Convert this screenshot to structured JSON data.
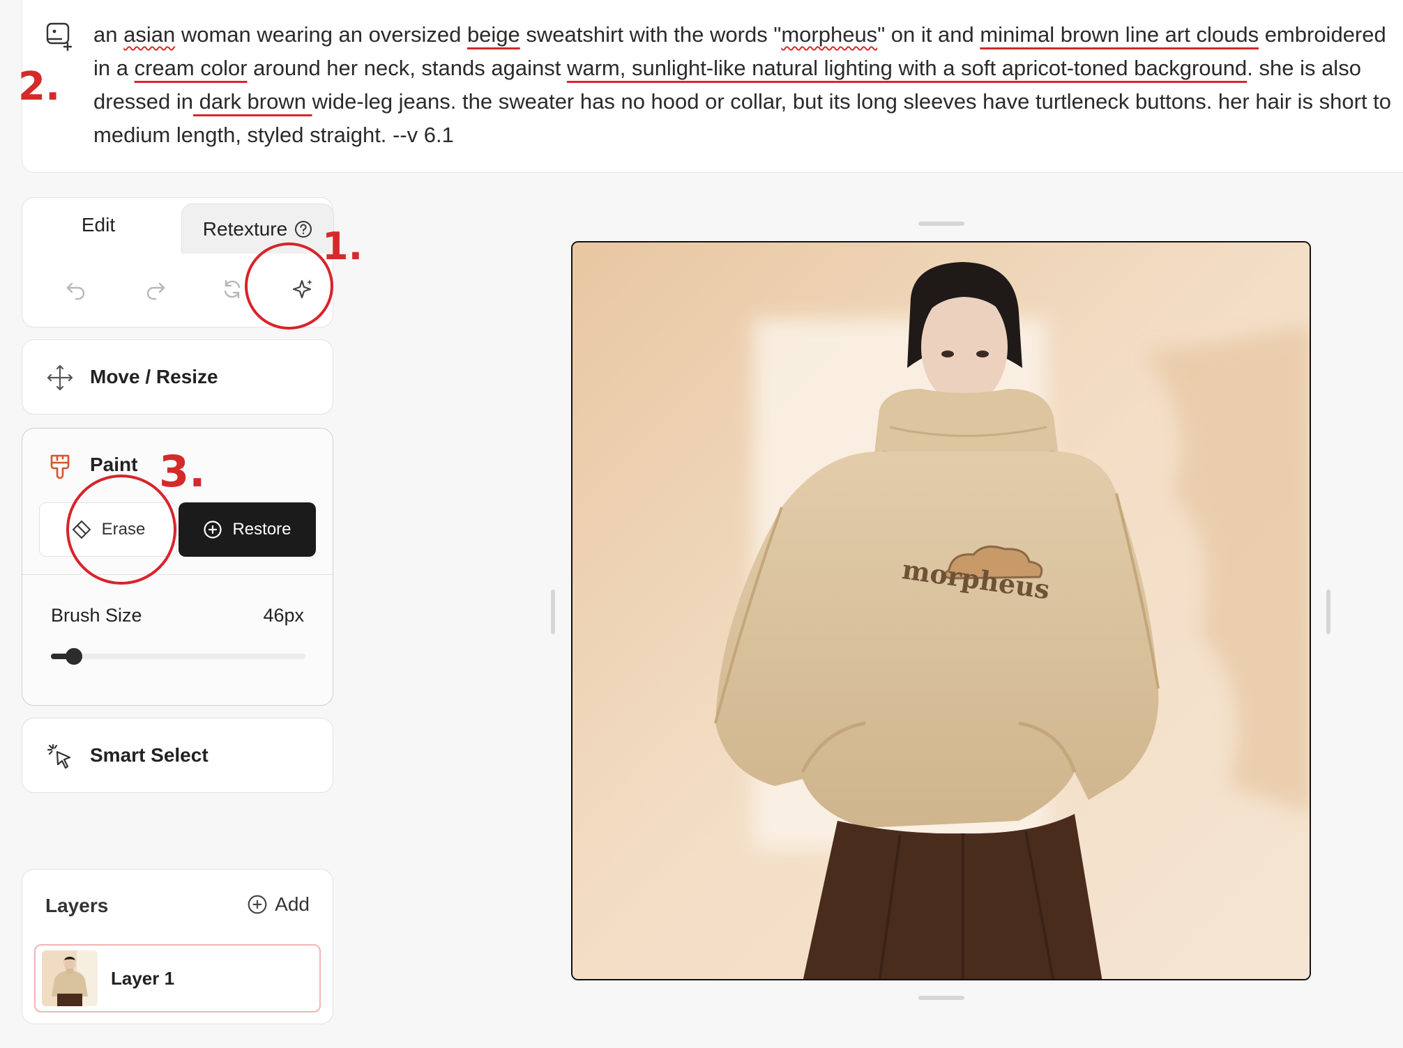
{
  "prompt": {
    "segments": [
      {
        "text": "an ",
        "style": "plain"
      },
      {
        "text": "asian",
        "style": "spell"
      },
      {
        "text": " woman wearing an oversized ",
        "style": "plain"
      },
      {
        "text": "beige",
        "style": "highlight"
      },
      {
        "text": " sweatshirt with the words \"",
        "style": "plain"
      },
      {
        "text": "morpheus",
        "style": "spell"
      },
      {
        "text": "\" on it and ",
        "style": "plain"
      },
      {
        "text": "minimal brown line art clouds",
        "style": "highlight"
      },
      {
        "text": " embroidered in a ",
        "style": "plain"
      },
      {
        "text": "cream color",
        "style": "highlight"
      },
      {
        "text": " around her neck, stands against ",
        "style": "plain"
      },
      {
        "text": "warm, sunlight-like natural lighting with a soft apricot-toned background",
        "style": "highlight"
      },
      {
        "text": ". she is also dressed in",
        "style": "plain"
      },
      {
        "text": " dark brown ",
        "style": "highlight"
      },
      {
        "text": "wide-leg jeans. the sweater has no hood or collar, but its long sleeves have turtleneck buttons. her hair is short to medium length, styled straight. --v 6.1",
        "style": "plain"
      }
    ],
    "icon": "image-edit-icon"
  },
  "edit_panel": {
    "tabs": [
      {
        "label": "Edit",
        "active": true
      },
      {
        "label": "Retexture",
        "active": false
      }
    ],
    "tools": [
      "undo-icon",
      "redo-icon",
      "reset-icon",
      "sparkle-icon"
    ]
  },
  "move_resize": {
    "label": "Move / Resize",
    "icon": "move-arrows-icon"
  },
  "paint": {
    "label": "Paint",
    "icon": "paintbrush-icon",
    "erase_label": "Erase",
    "restore_label": "Restore",
    "brush_label": "Brush Size",
    "brush_value": "46px",
    "brush_fraction": 0.09
  },
  "smart_select": {
    "label": "Smart Select",
    "icon": "pointer-sparkle-icon"
  },
  "layers": {
    "title": "Layers",
    "add_label": "Add",
    "items": [
      {
        "name": "Layer 1"
      }
    ]
  },
  "canvas": {
    "shirt_text": "morpheus",
    "colors": {
      "background": "#f1dcc2",
      "sweater": "#d9c29e",
      "pants": "#4a2c1d",
      "hair": "#1f1a18"
    }
  },
  "annotations": [
    {
      "label": "1."
    },
    {
      "label": "2."
    },
    {
      "label": "3."
    }
  ],
  "colors": {
    "annotation_red": "#d42a2a",
    "restore_bg": "#1b1b1b",
    "paint_icon": "#d9532c"
  }
}
